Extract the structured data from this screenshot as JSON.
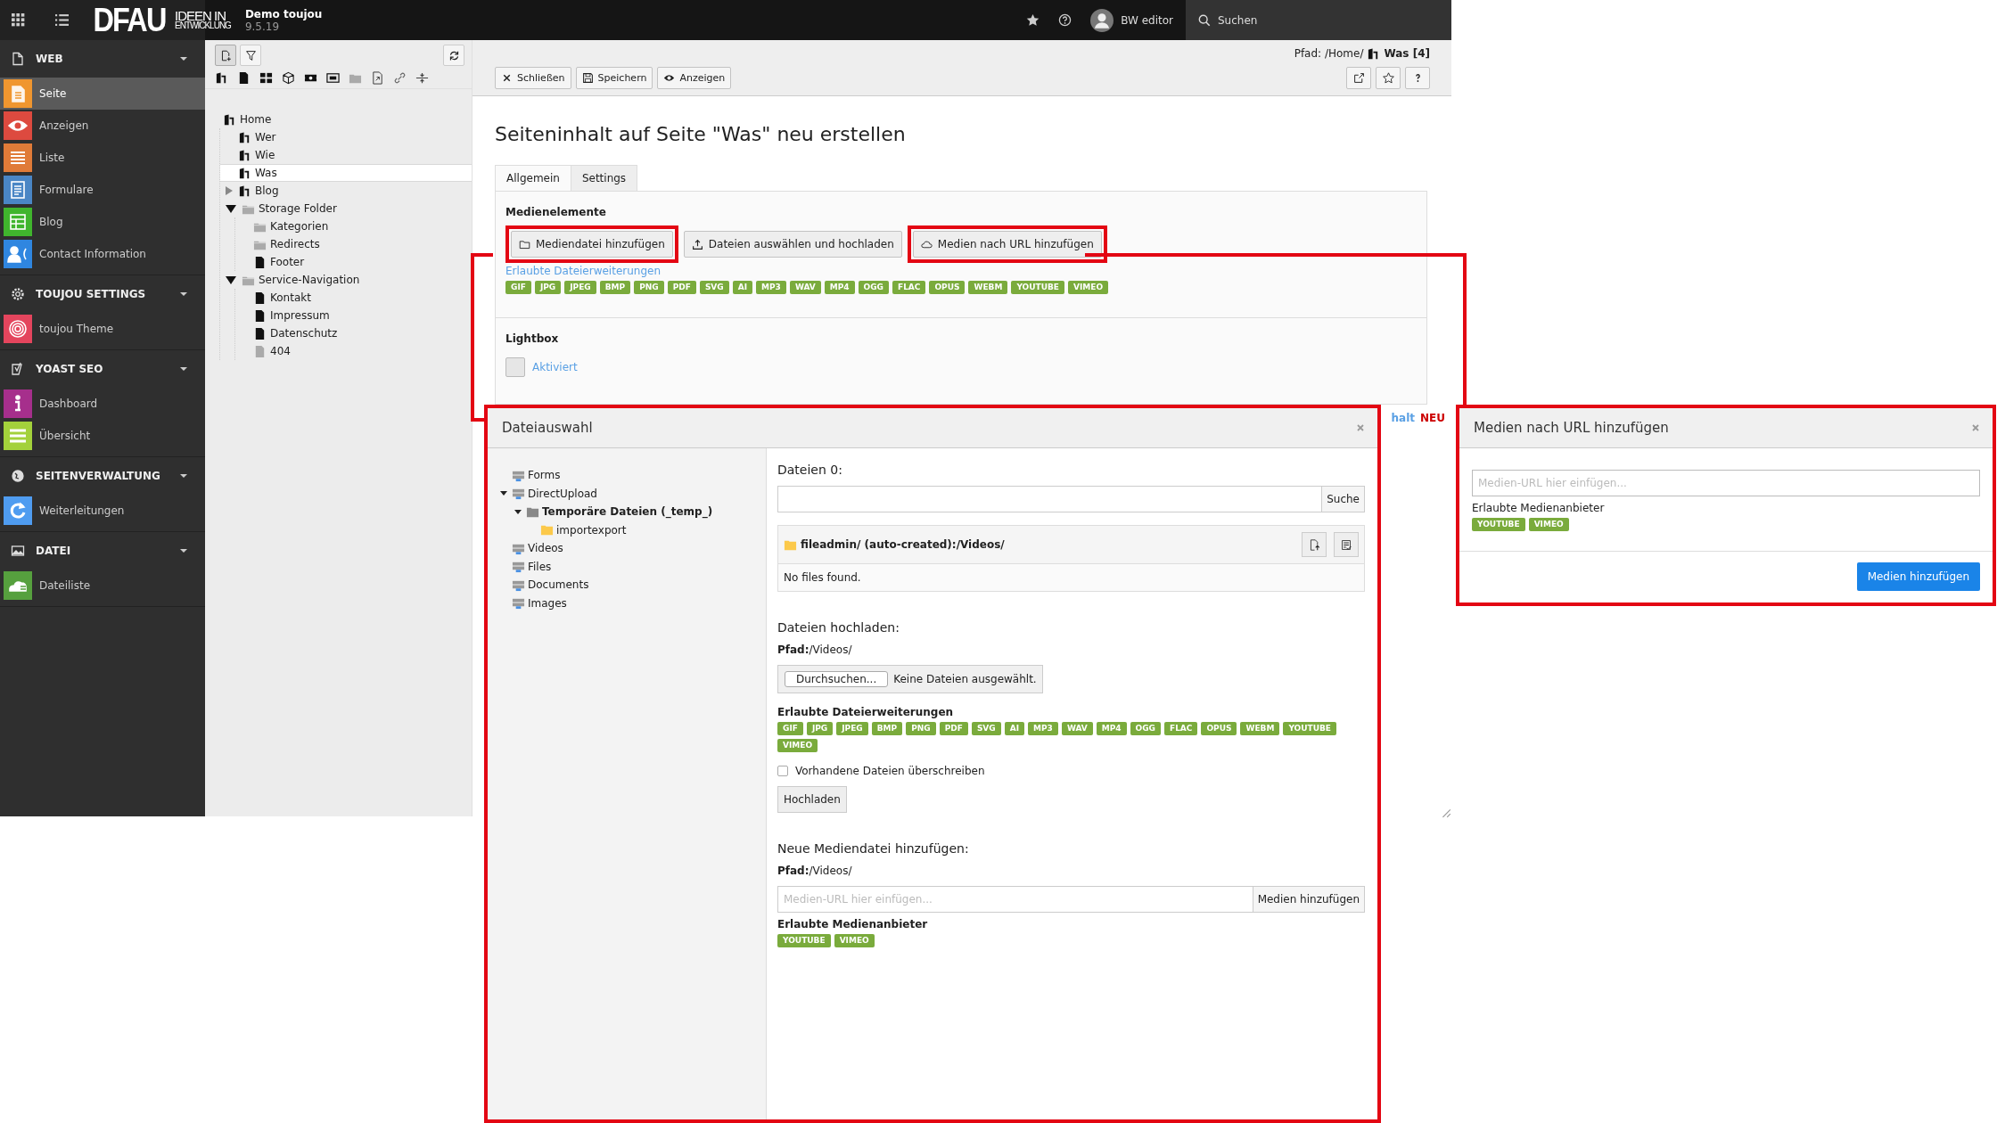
{
  "topbar": {
    "logo": "DFAU",
    "logo_top": "IDEEN IN",
    "logo_bottom": "ENTWICKLUNG",
    "site_name": "Demo toujou",
    "version": "9.5.19",
    "user": "BW editor",
    "search": "Suchen"
  },
  "modules": [
    {
      "title": "WEB",
      "kind": "doc",
      "expanded": true,
      "items": [
        {
          "label": "Seite",
          "kind": "page",
          "color": "#f0962f",
          "selected": true
        },
        {
          "label": "Anzeigen",
          "kind": "eye",
          "color": "#dd4a3f",
          "selected": false
        },
        {
          "label": "Liste",
          "kind": "list",
          "color": "#e07b38",
          "selected": false
        },
        {
          "label": "Formulare",
          "kind": "form",
          "color": "#4a86c5",
          "selected": false
        },
        {
          "label": "Blog",
          "kind": "grid",
          "color": "#40b52d",
          "selected": false
        },
        {
          "label": "Contact Information",
          "kind": "contact",
          "color": "#2f86e0",
          "selected": false
        }
      ]
    },
    {
      "title": "TOUJOU SETTINGS",
      "kind": "gear",
      "expanded": true,
      "items": [
        {
          "label": "toujou Theme",
          "kind": "fingerprint",
          "color": "#e4455d",
          "selected": false
        }
      ]
    },
    {
      "title": "YOAST SEO",
      "kind": "yoast",
      "expanded": true,
      "items": [
        {
          "label": "Dashboard",
          "kind": "info",
          "color": "#a62f8c",
          "selected": false
        },
        {
          "label": "Übersicht",
          "kind": "lines",
          "color": "#a3d13b",
          "selected": false
        }
      ]
    },
    {
      "title": "SEITENVERWALTUNG",
      "kind": "globe",
      "expanded": true,
      "items": [
        {
          "label": "Weiterleitungen",
          "kind": "refresh",
          "color": "#4f9cf0",
          "selected": false
        }
      ]
    },
    {
      "title": "DATEI",
      "kind": "image",
      "expanded": true,
      "items": [
        {
          "label": "Dateiliste",
          "kind": "cloud",
          "color": "#56a03e",
          "selected": false
        }
      ]
    }
  ],
  "page_tree": {
    "nodes": [
      {
        "label": "Home",
        "kind": "site",
        "selected": false,
        "children": [
          {
            "label": "Wer",
            "kind": "site",
            "selected": false
          },
          {
            "label": "Wie",
            "kind": "site",
            "selected": false
          },
          {
            "label": "Was",
            "kind": "site",
            "selected": true
          },
          {
            "label": "Blog",
            "kind": "site",
            "expanded": false,
            "selected": false
          },
          {
            "label": "Storage Folder",
            "kind": "folder",
            "expanded": true,
            "selected": false,
            "children": [
              {
                "label": "Kategorien",
                "kind": "folder",
                "selected": false
              },
              {
                "label": "Redirects",
                "kind": "folder",
                "selected": false
              },
              {
                "label": "Footer",
                "kind": "page",
                "selected": false
              }
            ]
          },
          {
            "label": "Service-Navigation",
            "kind": "folder",
            "expanded": true,
            "selected": false,
            "children": [
              {
                "label": "Kontakt",
                "kind": "page",
                "selected": false
              },
              {
                "label": "Impressum",
                "kind": "page",
                "selected": false
              },
              {
                "label": "Datenschutz",
                "kind": "page",
                "selected": false
              },
              {
                "label": "404",
                "kind": "page-hidden",
                "selected": false
              }
            ]
          }
        ]
      }
    ]
  },
  "doc_header": {
    "path_prefix": "Pfad: /Home/",
    "path_page": "Was [4]",
    "buttons": [
      {
        "label": "Schließen",
        "kind": "close"
      },
      {
        "label": "Speichern",
        "kind": "save"
      },
      {
        "label": "Anzeigen",
        "kind": "eye"
      }
    ]
  },
  "content": {
    "heading": "Seiteninhalt auf Seite \"Was\" neu erstellen",
    "tabs": [
      {
        "label": "Allgemein",
        "selected": true
      },
      {
        "label": "Settings",
        "selected": false
      }
    ],
    "media": {
      "title": "Medienelemente",
      "buttons": [
        {
          "label": "Mediendatei hinzufügen",
          "kind": "folder",
          "highlighted": true
        },
        {
          "label": "Dateien auswählen und hochladen",
          "kind": "upload",
          "highlighted": false
        },
        {
          "label": "Medien nach URL hinzufügen",
          "kind": "cloud",
          "highlighted": true
        }
      ],
      "extensions_link": "Erlaubte Dateierweiterungen",
      "extensions": [
        "GIF",
        "JPG",
        "JPEG",
        "BMP",
        "PNG",
        "PDF",
        "SVG",
        "AI",
        "MP3",
        "WAV",
        "MP4",
        "OGG",
        "FLAC",
        "OPUS",
        "WEBM",
        "YOUTUBE",
        "VIMEO"
      ]
    },
    "lightbox": {
      "title": "Lightbox",
      "label": "Aktiviert",
      "checked": false
    },
    "partial_link": "halt",
    "partial_badge": "NEU"
  },
  "file_dialog": {
    "title": "Dateiauswahl",
    "tree": [
      {
        "label": "Forms",
        "kind": "storage",
        "selected": false
      },
      {
        "label": "DirectUpload",
        "kind": "storage",
        "expanded": true,
        "selected": false,
        "children": [
          {
            "label": "Temporäre Dateien (_temp_)",
            "kind": "folder-gray",
            "expanded": true,
            "selected": true,
            "children": [
              {
                "label": "importexport",
                "kind": "folder-yellow",
                "selected": false
              }
            ]
          }
        ]
      },
      {
        "label": "Videos",
        "kind": "storage",
        "selected": false
      },
      {
        "label": "Files",
        "kind": "storage",
        "selected": false
      },
      {
        "label": "Documents",
        "kind": "storage",
        "selected": false
      },
      {
        "label": "Images",
        "kind": "storage",
        "selected": false
      }
    ],
    "files_heading": "Dateien 0:",
    "search_button": "Suche",
    "folder_path": "fileadmin/ (auto-created):/Videos/",
    "empty_text": "No files found.",
    "upload_heading": "Dateien hochladen:",
    "upload_path": "**Pfad:**/Videos/",
    "browse_button": "Durchsuchen...",
    "no_file_text": "Keine Dateien ausgewählt.",
    "extensions_title": "Erlaubte Dateierweiterungen",
    "extensions": [
      "GIF",
      "JPG",
      "JPEG",
      "BMP",
      "PNG",
      "PDF",
      "SVG",
      "AI",
      "MP3",
      "WAV",
      "MP4",
      "OGG",
      "FLAC",
      "OPUS",
      "WEBM",
      "YOUTUBE",
      "VIMEO"
    ],
    "overwrite_label": "Vorhandene Dateien überschreiben",
    "overwrite_checked": false,
    "upload_button": "Hochladen",
    "new_heading": "Neue Mediendatei hinzufügen:",
    "new_path": "**Pfad:**/Videos/",
    "url_placeholder": "Medien-URL hier einfügen...",
    "add_button": "Medien hinzufügen",
    "providers_title": "Erlaubte Medienanbieter",
    "providers": [
      "YOUTUBE",
      "VIMEO"
    ]
  },
  "url_dialog": {
    "title": "Medien nach URL hinzufügen",
    "placeholder": "Medien-URL hier einfügen...",
    "providers_title": "Erlaubte Medienanbieter",
    "providers": [
      "YOUTUBE",
      "VIMEO"
    ],
    "button": "Medien hinzufügen"
  }
}
